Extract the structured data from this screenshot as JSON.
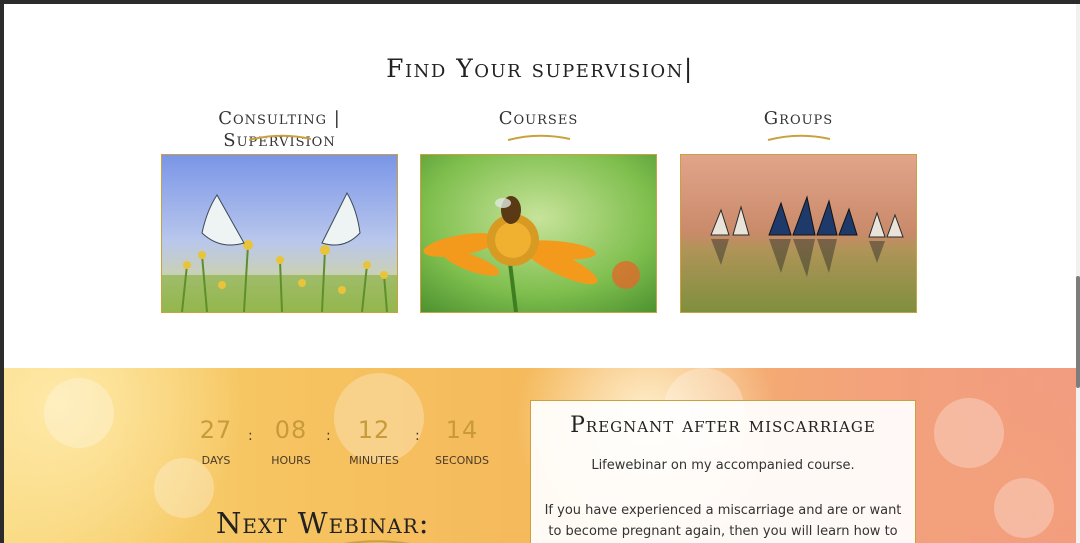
{
  "section": {
    "title": "Find Your supervision|"
  },
  "cards": [
    {
      "title": "Consulting | Supervision",
      "image": "white-butterflies-on-flowers"
    },
    {
      "title": "Courses",
      "image": "bee-on-orange-flower"
    },
    {
      "title": "Groups",
      "image": "butterflies-on-wet-sand"
    }
  ],
  "countdown": {
    "days": "27",
    "days_label": "DAYS",
    "hours": "08",
    "hours_label": "HOURS",
    "minutes": "12",
    "minutes_label": "MINUTES",
    "seconds": "14",
    "seconds_label": "SECONDS",
    "separator": ":"
  },
  "webinar": {
    "heading": "Next Webinar:"
  },
  "infobox": {
    "title": "Pregnant after miscarriage",
    "line1": "Lifewebinar on my accompanied course.",
    "line2": "If you have experienced a miscarriage and are or want",
    "line3": "to become pregnant again, then you will learn how to"
  },
  "colors": {
    "accent": "#c9a23f",
    "countdown_number": "#c99a3a"
  }
}
